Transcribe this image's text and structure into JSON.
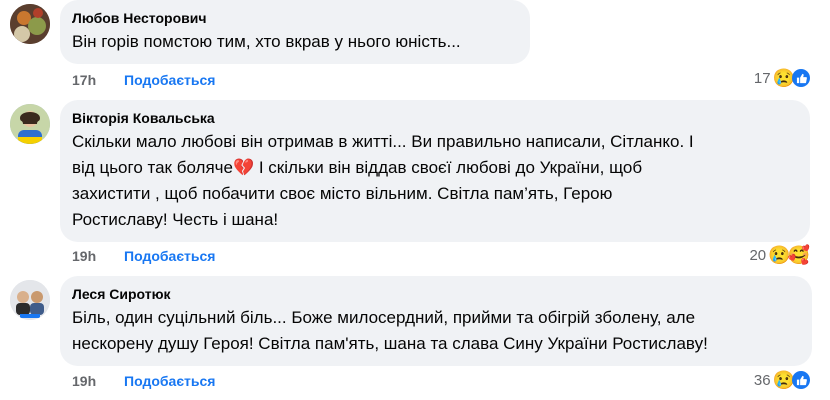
{
  "comments": [
    {
      "author": "Любов Несторович",
      "lines": [
        "Він горів помстою тим, хто вкрав у нього юність..."
      ],
      "time": "17h",
      "like_label": "Подобається",
      "reaction_count": "17",
      "reactions": [
        "sad-emoji",
        "like-icon"
      ]
    },
    {
      "author": "Вікторія Ковальська",
      "lines": [
        "Скільки мало любові він отримав в житті... Ви правильно написали, Сітланко. І",
        "від цього так боляче💔 І скільки він віддав своєї любові до України, щоб",
        "захистити , щоб побачити своє місто вільним. Світла пам’ять, Герою",
        "Ростиславу! Честь і шана!"
      ],
      "time": "19h",
      "like_label": "Подобається",
      "reaction_count": "20",
      "reactions": [
        "sad-emoji",
        "care-emoji"
      ]
    },
    {
      "author": "Леся Сиротюк",
      "lines": [
        "Біль, один суцільний біль... Боже милосердний, прийми та обігрій зболену, але",
        "нескорену душу Героя! Світла пам'ять, шана та слава Сину України Ростиславу!"
      ],
      "time": "19h",
      "like_label": "Подобається",
      "reaction_count": "36",
      "reactions": [
        "sad-emoji",
        "like-icon"
      ]
    }
  ]
}
